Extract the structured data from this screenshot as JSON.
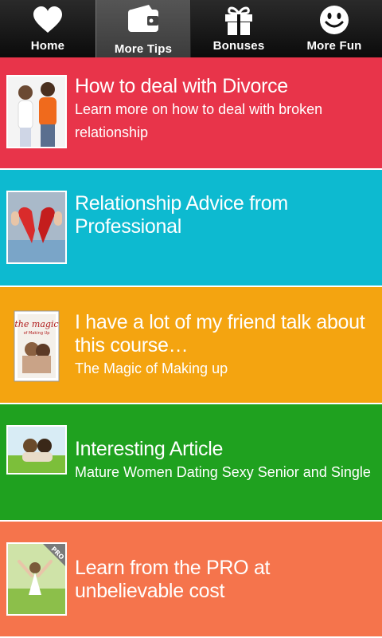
{
  "tabs": [
    {
      "label": "Home",
      "icon": "heart-icon"
    },
    {
      "label": "More Tips",
      "icon": "wallet-icon"
    },
    {
      "label": "Bonuses",
      "icon": "gift-icon"
    },
    {
      "label": "More Fun",
      "icon": "smiley-icon"
    }
  ],
  "active_tab": "More Tips",
  "cards": [
    {
      "title": "How to deal with Divorce",
      "subtitle": "Learn more on how to deal with broken relationship",
      "color": "#e8344a",
      "thumb": "couple-arguing-image"
    },
    {
      "title": "Relationship Advice from Professional",
      "subtitle": "",
      "color": "#0dbad0",
      "thumb": "broken-heart-image"
    },
    {
      "title": "I have a lot of my friend talk about this course…",
      "subtitle": "The Magic of Making up",
      "color": "#f4a410",
      "thumb": "book-cover-image"
    },
    {
      "title": "Interesting Article",
      "subtitle": "Mature Women Dating Sexy Senior and Single",
      "color": "#1fa11f",
      "thumb": "couple-on-grass-image"
    },
    {
      "title": "Learn from the PRO at unbelievable cost",
      "subtitle": "",
      "color": "#f5744c",
      "thumb": "woman-in-field-image"
    }
  ],
  "thumb_badges": {
    "pro": "PRO",
    "book_title": "the magic",
    "book_subtitle": "of Making Up"
  }
}
